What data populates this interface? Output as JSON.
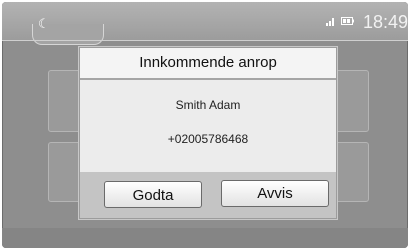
{
  "status_bar": {
    "moon_icon": "moon-icon",
    "signal_icon": "signal-icon",
    "battery_icon": "battery-icon",
    "time": "18:49"
  },
  "dialog": {
    "title": "Innkommende anrop",
    "caller_name": "Smith Adam",
    "caller_number": "+02005786468",
    "accept_label": "Godta",
    "reject_label": "Avvis"
  },
  "colors": {
    "screen_bg": "#8e8e8e",
    "dialog_bg": "#ececec",
    "button_area": "#c4c4c4",
    "status_text": "#f2f2f2"
  }
}
